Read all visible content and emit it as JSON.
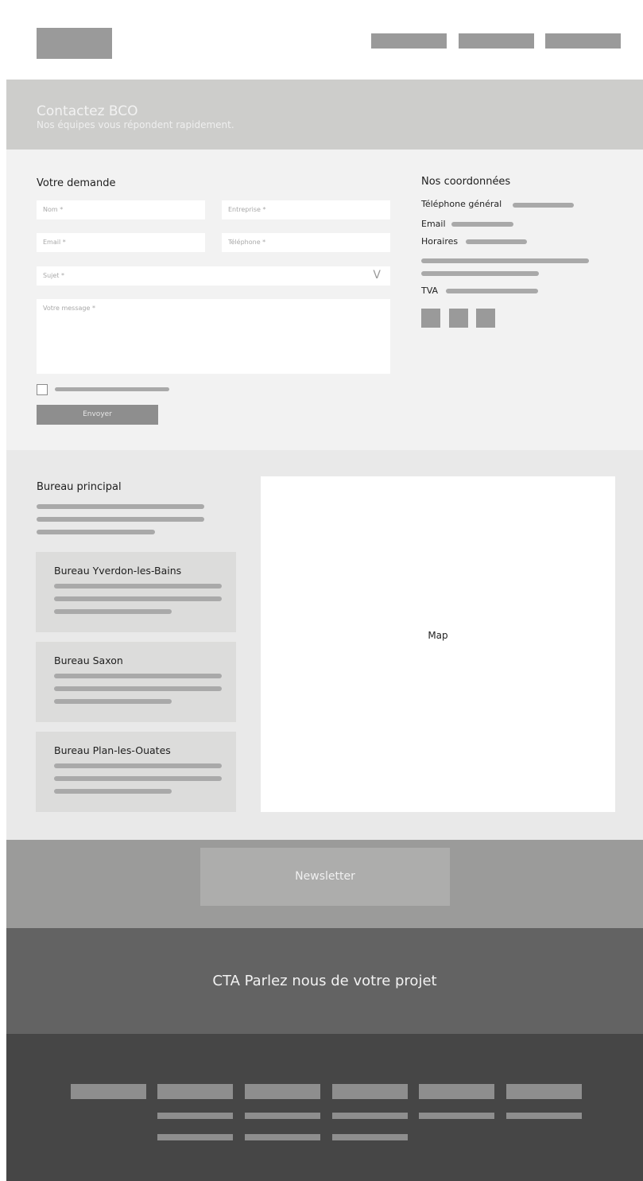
{
  "hero": {
    "title": "Contactez BCO",
    "subtitle": "Nos équipes vous répondent rapidement."
  },
  "form": {
    "heading": "Votre demande",
    "fields": {
      "nom": "Nom *",
      "entreprise": "Entreprise *",
      "email": "Email *",
      "telephone": "Téléphone *",
      "sujet": "Sujet *",
      "message": "Votre message *"
    },
    "submit_label": "Envoyer",
    "chevron": "V"
  },
  "coordinates": {
    "heading": "Nos coordonnées",
    "telephone_label": "Téléphone général",
    "email_label": "Email",
    "hours_label": "Horaires",
    "tva_label": "TVA",
    "social_icons": [
      "social-icon-1",
      "social-icon-2",
      "social-icon-3"
    ]
  },
  "offices": {
    "main_heading": "Bureau principal",
    "cards": [
      {
        "title": "Bureau Yverdon-les-Bains"
      },
      {
        "title": "Bureau Saxon"
      },
      {
        "title": "Bureau Plan-les-Ouates"
      }
    ],
    "map_label": "Map"
  },
  "newsletter": {
    "label": "Newsletter"
  },
  "cta": {
    "label": "CTA Parlez nous de votre projet"
  },
  "colors": {
    "hero_bg": "#cdcdcb",
    "placeholder_block": "#9a9a9a",
    "cta_bg": "#636363",
    "footer_bg": "#464646"
  }
}
